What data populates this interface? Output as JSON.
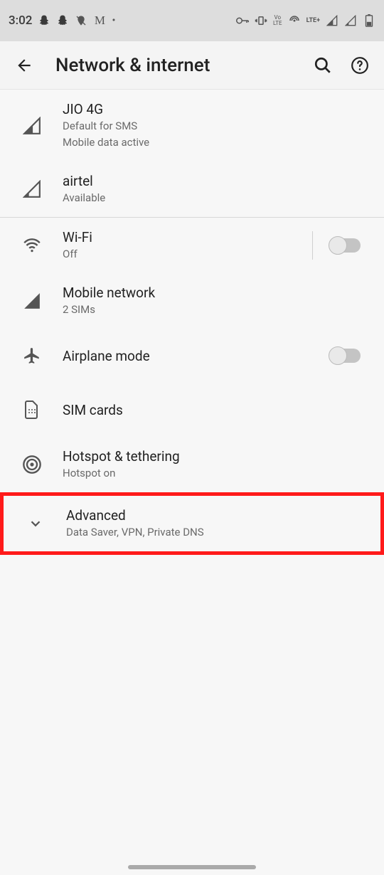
{
  "status": {
    "time": "3:02",
    "dnd_txt": "Vo\nLTE",
    "lte_txt": "LTE+"
  },
  "header": {
    "title": "Network & internet"
  },
  "sim1": {
    "title": "JIO 4G",
    "line1": "Default for SMS",
    "line2": "Mobile data active"
  },
  "sim2": {
    "title": "airtel",
    "line1": "Available"
  },
  "wifi": {
    "title": "Wi-Fi",
    "sub": "Off"
  },
  "mobile": {
    "title": "Mobile network",
    "sub": "2 SIMs"
  },
  "airplane": {
    "title": "Airplane mode"
  },
  "simcards": {
    "title": "SIM cards"
  },
  "hotspot": {
    "title": "Hotspot & tethering",
    "sub": "Hotspot on"
  },
  "advanced": {
    "title": "Advanced",
    "sub": "Data Saver, VPN, Private DNS"
  }
}
